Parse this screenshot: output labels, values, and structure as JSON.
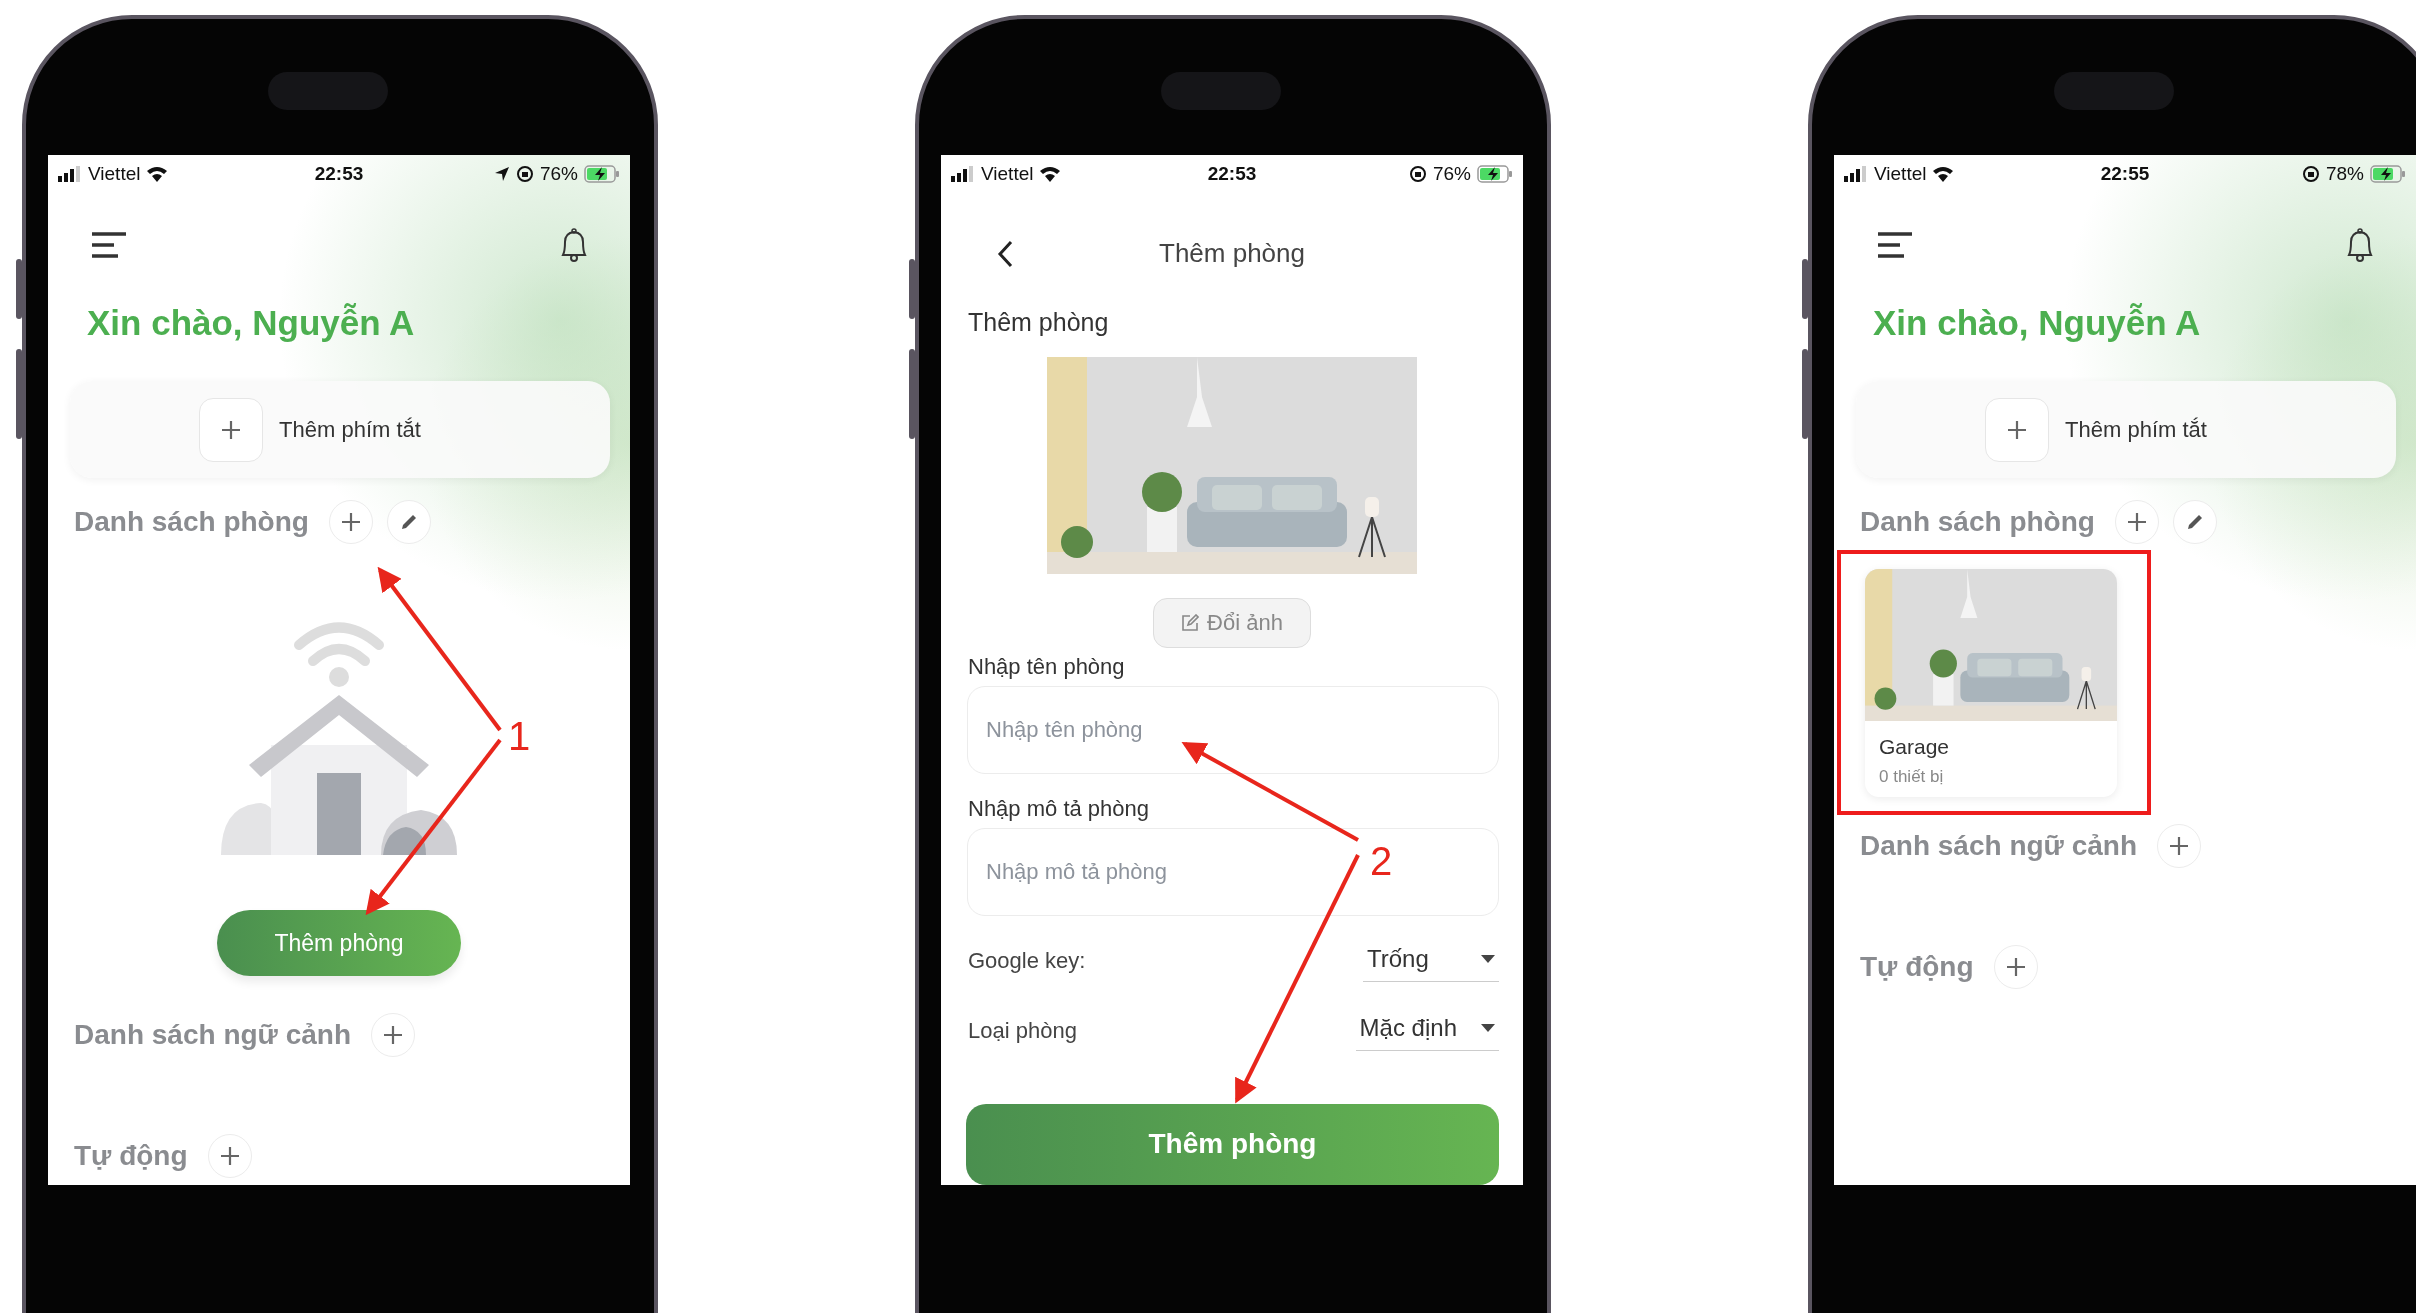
{
  "phones": [
    {
      "kind": "home",
      "status_bar": {
        "carrier": "Viettel",
        "time": "22:53",
        "battery": "76%",
        "location": true
      },
      "greeting": "Xin chào, Nguyễn A",
      "shortcut": "Thêm phím tắt",
      "rooms_title": "Danh sách phòng",
      "empty_action": "Thêm phòng",
      "scenes_title": "Danh sách ngữ cảnh",
      "auto_title": "Tự động"
    },
    {
      "kind": "form",
      "status_bar": {
        "carrier": "Viettel",
        "time": "22:53",
        "battery": "76%",
        "location": false
      },
      "title": "Thêm phòng",
      "section": "Thêm phòng",
      "change_photo": "Đổi ảnh",
      "fields": [
        {
          "label": "Nhập tên phòng",
          "placeholder": "Nhập tên phòng"
        },
        {
          "label": "Nhập mô tả phòng",
          "placeholder": "Nhập mô tả phòng"
        }
      ],
      "selects": [
        {
          "label": "Google key:",
          "value": "Trống"
        },
        {
          "label": "Loại phòng",
          "value": "Mặc định"
        }
      ],
      "submit": "Thêm phòng"
    },
    {
      "kind": "home",
      "status_bar": {
        "carrier": "Viettel",
        "time": "22:55",
        "battery": "78%",
        "location": false
      },
      "greeting": "Xin chào, Nguyễn A",
      "shortcut": "Thêm phím tắt",
      "rooms_title": "Danh sách phòng",
      "rooms": [
        {
          "name": "Garage",
          "devices": "0 thiết bị",
          "highlighted": true
        }
      ],
      "scenes_title": "Danh sách ngữ cảnh",
      "auto_title": "Tự động"
    }
  ],
  "annotations": [
    {
      "number": "1"
    },
    {
      "number": "2"
    }
  ]
}
